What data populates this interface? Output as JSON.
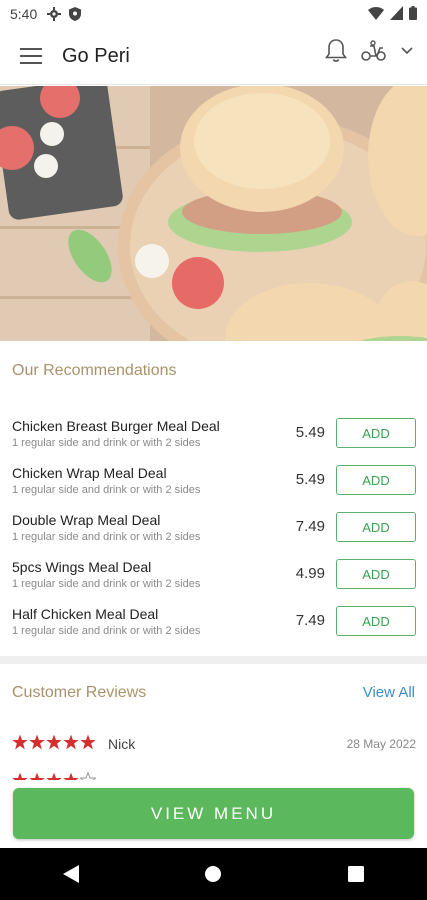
{
  "status": {
    "time": "5:40"
  },
  "app": {
    "title": "Go Peri"
  },
  "recommendations": {
    "title": "Our Recommendations",
    "add_label": "ADD",
    "items": [
      {
        "name": "Chicken Breast Burger Meal Deal",
        "desc": "1 regular side and drink or with 2 sides",
        "price": "5.49"
      },
      {
        "name": "Chicken Wrap Meal Deal",
        "desc": "1 regular side and drink or with 2 sides",
        "price": "5.49"
      },
      {
        "name": "Double Wrap Meal Deal",
        "desc": "1 regular side and drink or with  2 sides",
        "price": "7.49"
      },
      {
        "name": "5pcs Wings Meal Deal",
        "desc": "1 regular side and drink or with 2 sides",
        "price": "4.99"
      },
      {
        "name": "Half Chicken Meal Deal",
        "desc": "1 regular side and drink or with  2 sides",
        "price": "7.49"
      }
    ]
  },
  "reviews": {
    "title": "Customer Reviews",
    "view_all": "View All",
    "items": [
      {
        "name": "Nick",
        "date": "28 May 2022",
        "rating": 5
      },
      {
        "name": "",
        "date": "",
        "rating": 4
      }
    ]
  },
  "footer": {
    "view_menu": "VIEW MENU"
  },
  "colors": {
    "accent": "#5cb85c",
    "section_title": "#a8926a",
    "star": "#d32f2f",
    "link": "#3c8ec7"
  }
}
